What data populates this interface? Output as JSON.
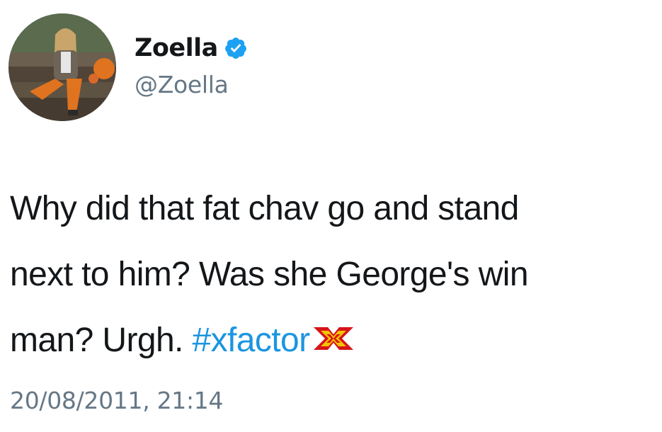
{
  "author": {
    "display_name": "Zoella",
    "handle": "@Zoella",
    "verified": true,
    "avatar_icon": "profile-photo",
    "verified_icon": "verified-badge-icon"
  },
  "tweet": {
    "lines": [
      "Why did that fat chav go and stand",
      "next to him? Was she George's win",
      "man? Urgh. "
    ],
    "hashtag": "#xfactor",
    "hashtag_icon": "x-factor-logo-icon",
    "timestamp": "20/08/2011, 21:14"
  },
  "colors": {
    "text": "#14171a",
    "secondary": "#657786",
    "link": "#1b95e0",
    "verified": "#1da1f2",
    "xfactor_red": "#d7141a"
  }
}
